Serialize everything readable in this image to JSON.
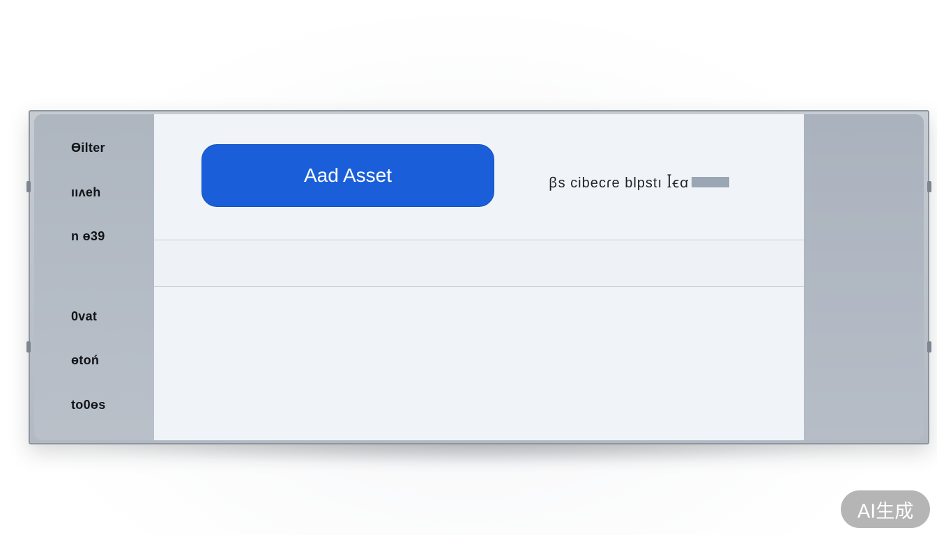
{
  "sidebar": {
    "items": [
      {
        "label": "Ɵilter"
      },
      {
        "label": "ııʌeh"
      },
      {
        "label": "n ɵ39"
      },
      {
        "label": "0vat"
      },
      {
        "label": "ɵtoń"
      },
      {
        "label": "to0ɵs"
      }
    ]
  },
  "toolbar": {
    "add_label": "Aad Asset",
    "status_text": "ꞵs  cibecɾe  blpstı ꟾꞓꭤ"
  },
  "colors": {
    "accent": "#1a5fd9",
    "sidebar": "#b3bac4",
    "background": "#f0f3f7"
  },
  "watermark": {
    "label": "AI生成"
  }
}
